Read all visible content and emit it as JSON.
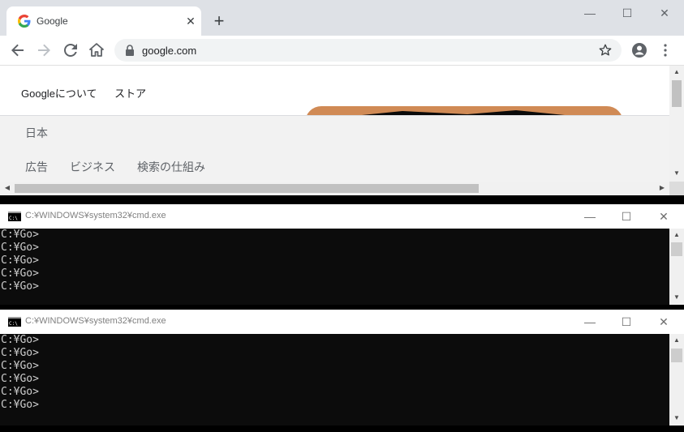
{
  "browser": {
    "tab_title": "Google",
    "tab_close": "✕",
    "new_tab": "+",
    "url": "google.com",
    "window_controls": {
      "minimize": "—",
      "maximize": "☐",
      "close": "✕"
    }
  },
  "page": {
    "top_links": [
      "Googleについて",
      "ストア"
    ],
    "country": "日本",
    "footer_links": [
      "広告",
      "ビジネス",
      "検索の仕組み"
    ]
  },
  "cmd_windows": [
    {
      "title": "C:¥WINDOWS¥system32¥cmd.exe",
      "lines": [
        "C:¥Go>",
        "C:¥Go>",
        "C:¥Go>",
        "C:¥Go>",
        "C:¥Go>"
      ]
    },
    {
      "title": "C:¥WINDOWS¥system32¥cmd.exe",
      "lines": [
        "C:¥Go>",
        "C:¥Go>",
        "C:¥Go>",
        "C:¥Go>",
        "C:¥Go>",
        "C:¥Go>"
      ]
    }
  ],
  "cmd_controls": {
    "minimize": "—",
    "maximize": "☐",
    "close": "✕"
  },
  "colors": {
    "tabstrip": "#dee1e6",
    "omnibox": "#f1f3f4",
    "footer": "#f2f2f2",
    "console_bg": "#0c0c0c",
    "console_text": "#cccccc"
  },
  "icons": [
    "google-favicon-icon",
    "back-arrow-icon",
    "forward-arrow-icon",
    "reload-icon",
    "home-icon",
    "lock-icon",
    "star-icon",
    "account-icon",
    "kebab-menu-icon",
    "cmd-app-icon"
  ]
}
